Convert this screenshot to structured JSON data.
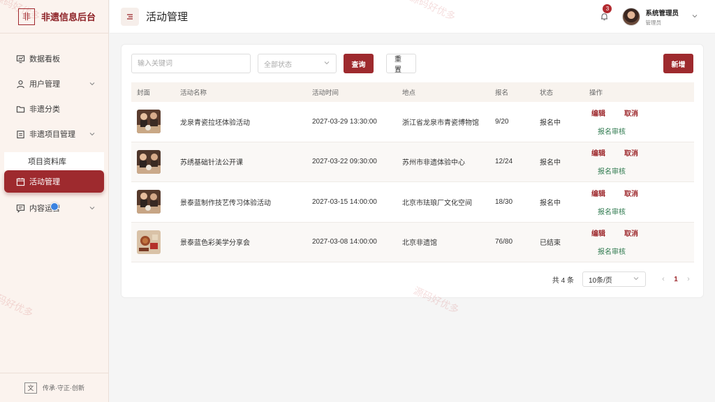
{
  "brand": {
    "logo_char": "非",
    "title": "非遗信息后台"
  },
  "sidebar": {
    "items": [
      {
        "label": "数据看板",
        "icon": "dashboard-icon"
      },
      {
        "label": "用户管理",
        "icon": "user-icon",
        "expandable": true
      },
      {
        "label": "非遗分类",
        "icon": "folder-icon"
      },
      {
        "label": "非遗项目管理",
        "icon": "clipboard-icon",
        "expandable": true
      },
      {
        "label": "活动管理",
        "icon": "calendar-icon",
        "active": true
      },
      {
        "label": "内容运营",
        "icon": "message-icon",
        "expandable": true
      }
    ],
    "sub_items": [
      {
        "label": "项目资料库"
      }
    ],
    "footer": {
      "badge": "文",
      "text": "传承·守正·创新"
    }
  },
  "header": {
    "title": "活动管理",
    "notification_count": "3",
    "user_name": "系统管理员",
    "user_role": "管理员"
  },
  "toolbar": {
    "keyword_placeholder": "输入关键词",
    "status_placeholder": "全部状态",
    "search_label": "查询",
    "reset_label": "重置",
    "new_label": "新增"
  },
  "table": {
    "columns": [
      "封面",
      "活动名称",
      "活动时间",
      "地点",
      "报名",
      "状态",
      "操作"
    ],
    "rows": [
      {
        "name": "龙泉青瓷拉坯体验活动",
        "time": "2027-03-29 13:30:00",
        "location": "浙江省龙泉市青瓷博物馆",
        "signup": "9/20",
        "status": "报名中"
      },
      {
        "name": "苏绣基础针法公开课",
        "time": "2027-03-22 09:30:00",
        "location": "苏州市非遗体验中心",
        "signup": "12/24",
        "status": "报名中"
      },
      {
        "name": "景泰蓝制作技艺传习体验活动",
        "time": "2027-03-15 14:00:00",
        "location": "北京市珐琅厂文化空间",
        "signup": "18/30",
        "status": "报名中"
      },
      {
        "name": "景泰蓝色彩美学分享会",
        "time": "2027-03-08 14:00:00",
        "location": "北京非遗馆",
        "signup": "76/80",
        "status": "已结束"
      }
    ],
    "ops": {
      "edit": "编辑",
      "cancel": "取消",
      "review": "报名审核"
    }
  },
  "pagination": {
    "total": "共 4 条",
    "page_size": "10条/页",
    "current": "1"
  },
  "watermark": "源码好优多",
  "colors": {
    "primary": "#9e2a2e",
    "review": "#2f7a4f",
    "sidebar_bg": "#fbf3ee"
  }
}
